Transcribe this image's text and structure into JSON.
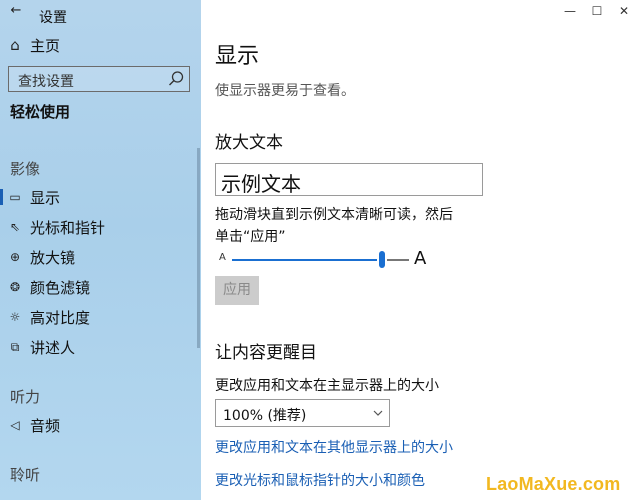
{
  "window": {
    "back_icon": "←",
    "title": "设置",
    "controls": {
      "minimize": "—",
      "maximize": "☐",
      "close": "✕"
    }
  },
  "sidebar": {
    "home": {
      "icon": "⌂",
      "label": "主页"
    },
    "search": {
      "placeholder": "查找设置"
    },
    "section_title": "轻松使用",
    "groups": [
      {
        "title": "影像",
        "items": [
          {
            "icon": "display-icon",
            "glyph": "▭",
            "label": "显示",
            "active": true
          },
          {
            "icon": "cursor-icon",
            "glyph": "⇖",
            "label": "光标和指针"
          },
          {
            "icon": "magnifier-icon",
            "glyph": "⊕",
            "label": "放大镜"
          },
          {
            "icon": "color-filter-icon",
            "glyph": "❂",
            "label": "颜色滤镜"
          },
          {
            "icon": "contrast-icon",
            "glyph": "☼",
            "label": "高对比度"
          },
          {
            "icon": "narrator-icon",
            "glyph": "⧉",
            "label": "讲述人"
          }
        ]
      },
      {
        "title": "听力",
        "items": [
          {
            "icon": "audio-icon",
            "glyph": "◁",
            "label": "音频"
          }
        ]
      },
      {
        "title": "聆听",
        "items": []
      }
    ]
  },
  "main": {
    "title": "显示",
    "subtitle": "使显示器更易于查看。",
    "enlarge_text": {
      "heading": "放大文本",
      "sample": "示例文本",
      "description_line1": "拖动滑块直到示例文本清晰可读，然后",
      "description_line2": "单击“应用”",
      "slider_small_label": "A",
      "slider_large_label": "A",
      "slider_value_fraction": 0.85,
      "apply_button": "应用"
    },
    "make_everything_bigger": {
      "heading": "让内容更醒目",
      "label": "更改应用和文本在主显示器上的大小",
      "dropdown_value": "100% (推荐)",
      "link1": "更改应用和文本在其他显示器上的大小",
      "link2": "更改光标和鼠标指针的大小和颜色"
    }
  },
  "watermark": "LaoMaXue.com",
  "colors": {
    "sidebar_bg": "#b4d4ec",
    "accent": "#1a6fd1",
    "link": "#1a5fb4",
    "watermark": "#f2b820",
    "disabled_button_bg": "#cccccc"
  }
}
